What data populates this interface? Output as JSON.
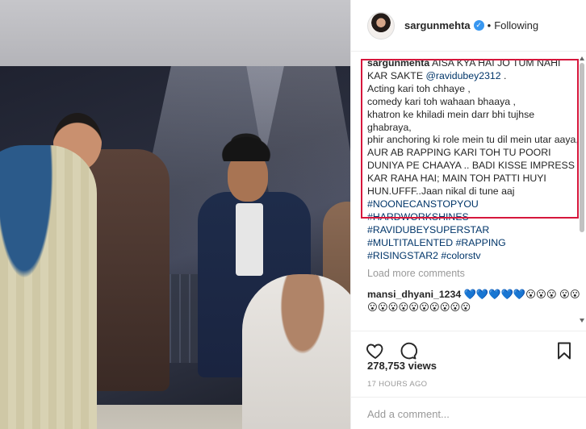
{
  "post": {
    "username": "sargunmehta",
    "follow_status": "Following",
    "separator": "•",
    "verified_mark": "✓"
  },
  "caption": {
    "username": "sargunmehta",
    "line1": "AISA KYA HAI JO TUM NAHI KAR SAKTE",
    "mention": "@ravidubey2312",
    "after_mention": " .",
    "lines": [
      "Acting kari toh chhaye ,",
      "comedy kari toh wahaan bhaaya ,",
      "khatron ke khiladi mein darr bhi tujhse ghabraya,",
      "phir anchoring ki role mein tu dil mein utar aaya,",
      "AUR AB RAPPING KARI TOH TU POORI DUNIYA PE CHAAYA .. BADI KISSE IMPRESS KAR RAHA HAI; MAIN TOH PATTI HUYI HUN.UFFF..Jaan nikal di tune aaj"
    ],
    "hashtags": [
      "#NOONECANSTOPYOU",
      "#HARDWORKSHINES",
      "#RAVIDUBEYSUPERSTAR",
      "#MULTITALENTED",
      "#RAPPING",
      "#RISINGSTAR2",
      "#colorstv"
    ]
  },
  "load_more": "Load more comments",
  "comment": {
    "username": "mansi_dhyani_1234",
    "text": "💙💙💙💙💙😮😮😮 😮😮😮😮😮😮😮😮😮😮😮😮"
  },
  "stats": {
    "views": "278,753 views",
    "time_ago": "17 HOURS AGO"
  },
  "add_comment": {
    "placeholder": "Add a comment..."
  },
  "icons": {
    "like": "heart-icon",
    "comment": "comment-icon",
    "save": "bookmark-icon"
  }
}
